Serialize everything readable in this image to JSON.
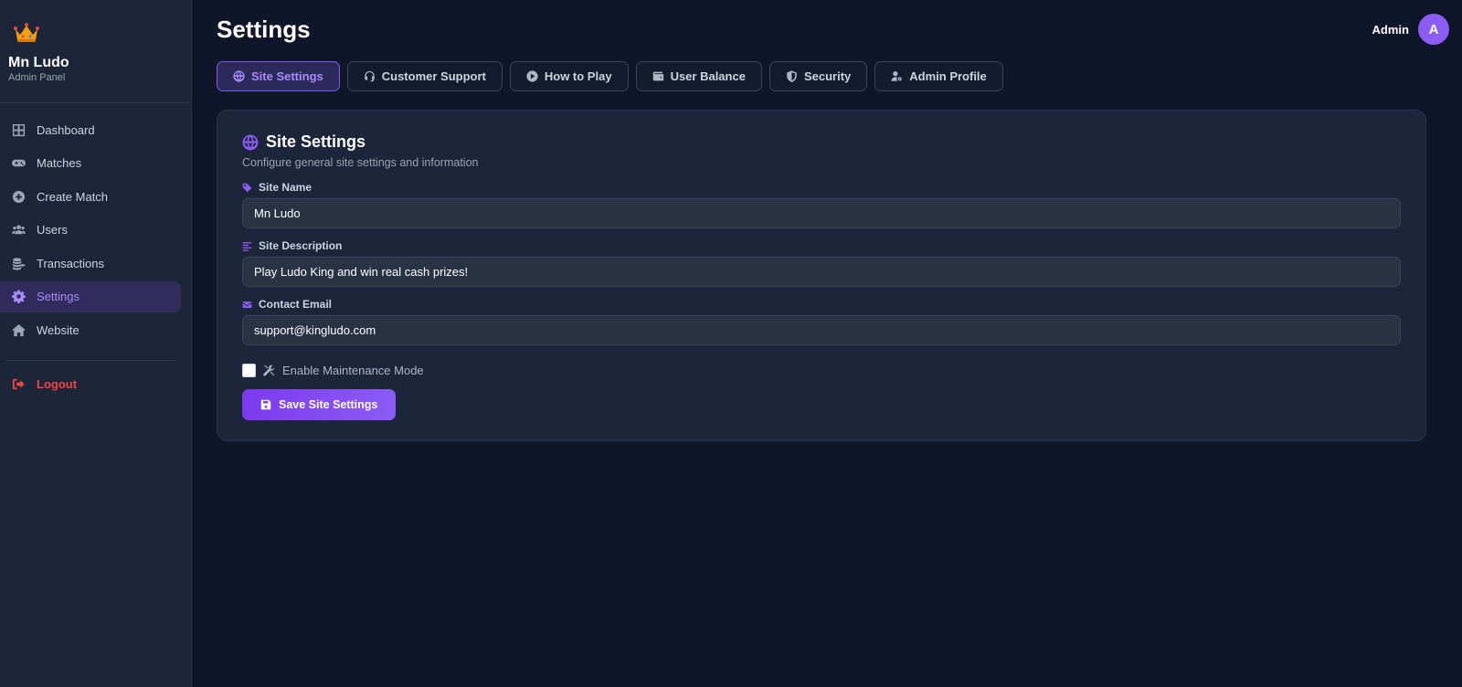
{
  "brand": {
    "name": "Mn Ludo",
    "subtitle": "Admin Panel",
    "logo_icon": "crown-icon"
  },
  "sidebar": {
    "items": [
      {
        "label": "Dashboard",
        "icon": "grid-icon"
      },
      {
        "label": "Matches",
        "icon": "gamepad-icon"
      },
      {
        "label": "Create Match",
        "icon": "plus-circle-icon"
      },
      {
        "label": "Users",
        "icon": "users-icon"
      },
      {
        "label": "Transactions",
        "icon": "coins-icon"
      },
      {
        "label": "Settings",
        "icon": "gear-icon",
        "active": true
      },
      {
        "label": "Website",
        "icon": "home-icon"
      }
    ],
    "logout_label": "Logout"
  },
  "header": {
    "title": "Settings",
    "user_name": "Admin",
    "avatar_initial": "A"
  },
  "tabs": [
    {
      "label": "Site Settings",
      "icon": "globe-icon",
      "active": true
    },
    {
      "label": "Customer Support",
      "icon": "headset-icon"
    },
    {
      "label": "How to Play",
      "icon": "play-circle-icon"
    },
    {
      "label": "User Balance",
      "icon": "wallet-icon"
    },
    {
      "label": "Security",
      "icon": "shield-icon"
    },
    {
      "label": "Admin Profile",
      "icon": "user-gear-icon"
    }
  ],
  "card": {
    "title": "Site Settings",
    "subtitle": "Configure general site settings and information",
    "fields": {
      "site_name": {
        "label": "Site Name",
        "value": "Mn Ludo"
      },
      "site_description": {
        "label": "Site Description",
        "value": "Play Ludo King and win real cash prizes!"
      },
      "contact_email": {
        "label": "Contact Email",
        "value": "support@kingludo.com"
      }
    },
    "maintenance_label": "Enable Maintenance Mode",
    "maintenance_enabled": false,
    "save_label": "Save Site Settings"
  },
  "colors": {
    "accent": "#8b5cf6",
    "danger": "#ef4444",
    "background": "#0f1629",
    "sidebar": "#1d2638"
  }
}
